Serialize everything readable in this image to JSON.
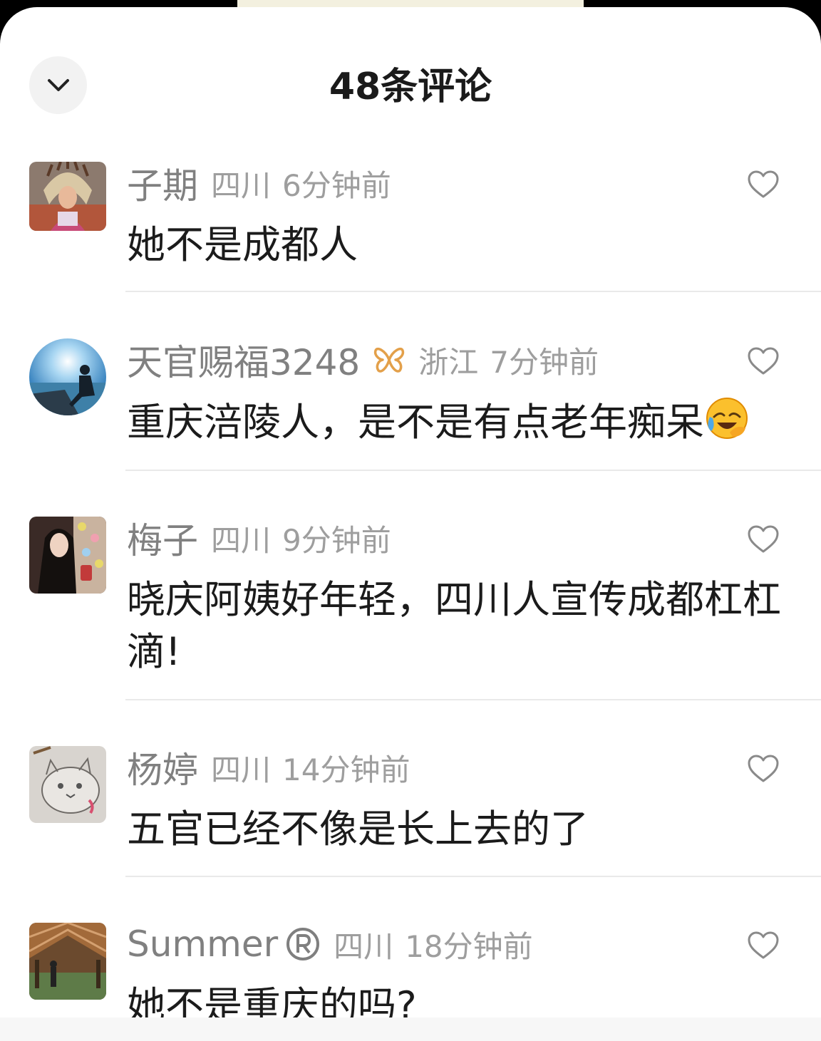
{
  "header": {
    "title": "48条评论"
  },
  "comments": [
    {
      "name": "子期",
      "region": "四川",
      "time": "6分钟前",
      "text": "她不是成都人"
    },
    {
      "name": "天官赐福3248",
      "region": "浙江",
      "time": "7分钟前",
      "text": "重庆涪陵人，是不是有点老年痴呆"
    },
    {
      "name": "梅子",
      "region": "四川",
      "time": "9分钟前",
      "text": "晓庆阿姨好年轻，四川人宣传成都杠杠滴!"
    },
    {
      "name": "杨婷",
      "region": "四川",
      "time": "14分钟前",
      "text": "五官已经不像是长上去的了"
    },
    {
      "name": "Summer",
      "region": "四川",
      "time": "18分钟前",
      "text": "她不是重庆的吗?"
    }
  ],
  "icons": {
    "collapse": "chevron-down-icon",
    "like": "heart-outline-icon",
    "vip": "butterfly-icon",
    "registered": "registered-mark-icon",
    "emoji": "laughing-crying-emoji"
  },
  "colors": {
    "nickname": "#808080",
    "meta": "#9e9e9e",
    "text": "#1b1b1b",
    "vip_badge": "#e3a04a"
  }
}
